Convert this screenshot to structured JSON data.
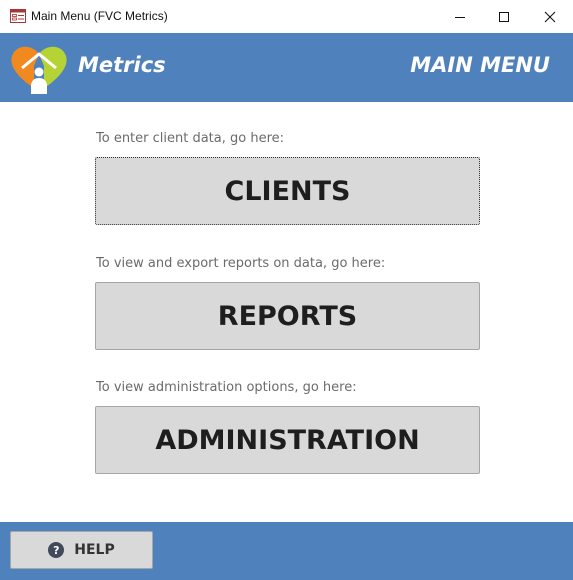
{
  "window": {
    "title": "Main Menu (FVC Metrics)",
    "app_icon": "form-icon",
    "controls": [
      "minimize-icon",
      "maximize-icon",
      "close-icon"
    ]
  },
  "header": {
    "app_name": "Metrics",
    "page_title": "MAIN MENU",
    "background": "#4f81bd",
    "logo_icon": "house-heart-logo"
  },
  "main": {
    "sections": [
      {
        "prompt": "To enter client data, go here:",
        "button_label": "CLIENTS"
      },
      {
        "prompt": "To view and export reports on data, go here:",
        "button_label": "REPORTS"
      },
      {
        "prompt": "To view administration options, go here:",
        "button_label": "ADMINISTRATION"
      }
    ]
  },
  "footer": {
    "help_label": "HELP",
    "help_icon": "question-circle-icon",
    "background": "#4f81bd"
  }
}
